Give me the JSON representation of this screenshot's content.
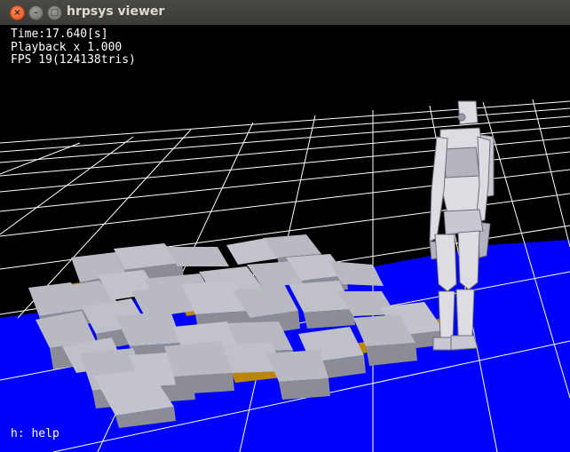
{
  "window": {
    "title": "hrpsys viewer",
    "close_glyph": "×",
    "minimize_glyph": "–",
    "maximize_glyph": "□"
  },
  "hud": {
    "time": "Time:17.640[s]",
    "playback": "Playback x 1.000",
    "fps": "FPS 19(124138tris)",
    "help": "h: help"
  },
  "scene": {
    "background_color": "#000000",
    "floor_color": "#0000ff",
    "grid_color": "#ffffff",
    "block_top_color": "#b9b9c2",
    "block_side_color": "#8c8c96",
    "block_base_color": "#b8860b",
    "robot_color": "#dcdce2"
  }
}
